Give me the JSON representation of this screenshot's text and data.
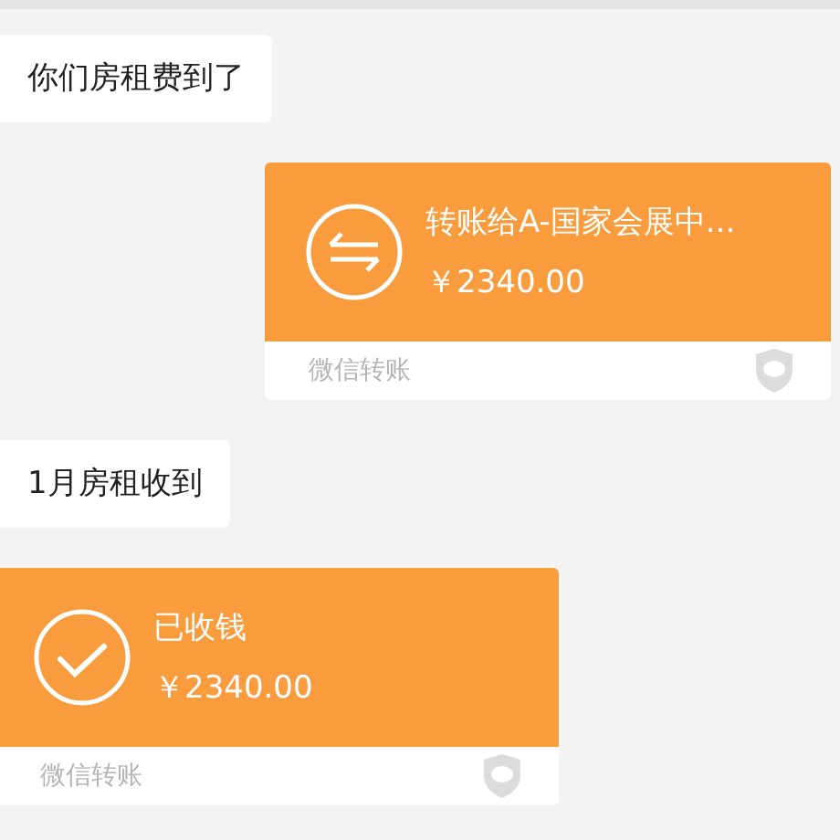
{
  "messages": [
    {
      "kind": "text",
      "sent": false,
      "text": "你们房租费到了"
    },
    {
      "kind": "transfer_out",
      "sent": true,
      "title": "转账给A-国家会展中...",
      "amount": "￥2340.00",
      "footer": "微信转账"
    },
    {
      "kind": "text",
      "sent": false,
      "text": "1月房租收到"
    },
    {
      "kind": "transfer_in",
      "sent": false,
      "title": "已收钱",
      "amount": "￥2340.00",
      "footer": "微信转账"
    }
  ]
}
